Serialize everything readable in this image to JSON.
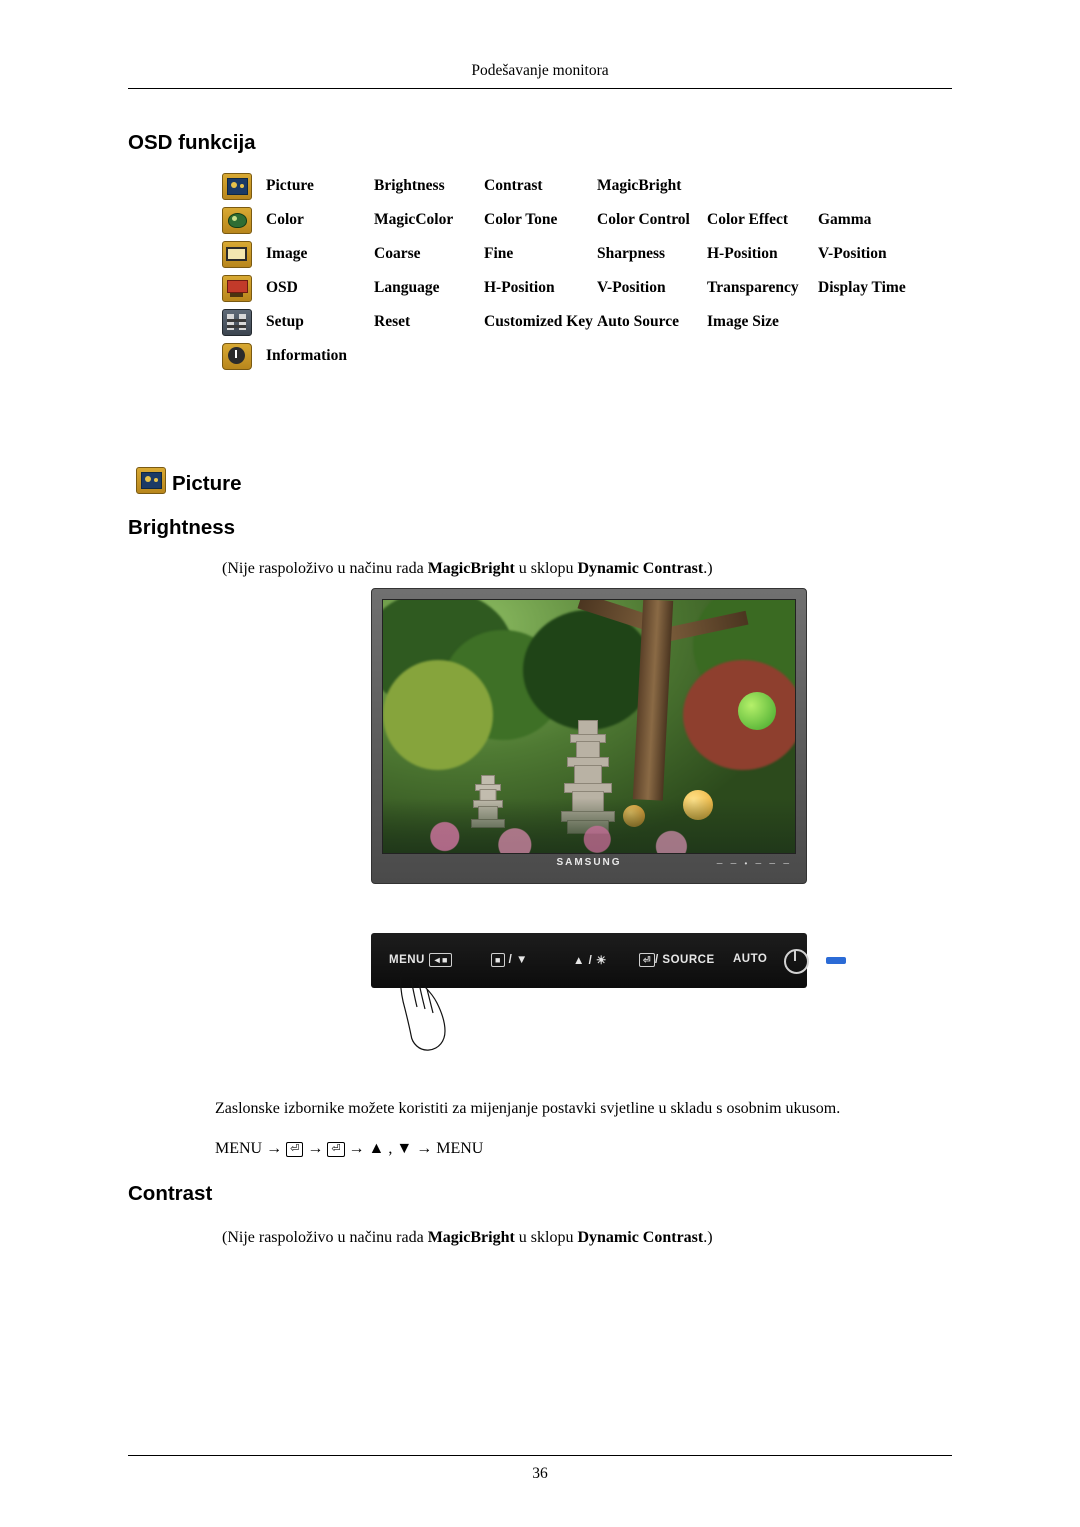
{
  "header": {
    "running_head": "Podešavanje monitora"
  },
  "footer": {
    "page_number": "36"
  },
  "headings": {
    "osd_funkcija": "OSD funkcija",
    "picture": "Picture",
    "brightness": "Brightness",
    "contrast": "Contrast"
  },
  "osd_table": {
    "rows": [
      {
        "icon": "picture-icon",
        "label": "Picture",
        "cells": [
          "Brightness",
          "Contrast",
          "MagicBright",
          "",
          ""
        ]
      },
      {
        "icon": "color-icon",
        "label": "Color",
        "cells": [
          "MagicColor",
          "Color Tone",
          "Color Control",
          "Color Effect",
          "Gamma"
        ]
      },
      {
        "icon": "image-icon",
        "label": "Image",
        "cells": [
          "Coarse",
          "Fine",
          "Sharpness",
          "H-Position",
          "V-Position"
        ]
      },
      {
        "icon": "osd-icon",
        "label": "OSD",
        "cells": [
          "Language",
          "H-Position",
          "V-Position",
          "Transparency",
          "Display Time"
        ]
      },
      {
        "icon": "setup-icon",
        "label": "Setup",
        "cells": [
          "Reset",
          "Customized Key",
          "Auto Source",
          "Image Size",
          ""
        ]
      },
      {
        "icon": "information-icon",
        "label": "Information",
        "cells": [
          "",
          "",
          "",
          "",
          ""
        ]
      }
    ]
  },
  "notes": {
    "brightness_note_prefix": "(Nije raspoloživo u načinu rada ",
    "magicbright": "MagicBright",
    "note_middle": " u sklopu ",
    "dynamic_contrast": "Dynamic Contrast",
    "note_suffix": ".)"
  },
  "body": {
    "description": "Zaslonske izbornike možete koristiti za mijenjanje postavki svjetline u skladu s osobnim ukusom.",
    "menu_path_start": "MENU →",
    "menu_path_middle": "→",
    "menu_path_arrows": "→ ▲ , ▼ → MENU"
  },
  "monitor": {
    "brand": "SAMSUNG",
    "bezel_buttons": "─ ─ • ─ ─ ─"
  },
  "control_panel": {
    "items": [
      {
        "name": "menu-button",
        "label": "MENU"
      },
      {
        "name": "brightness-down-button",
        "label": "/ ▼"
      },
      {
        "name": "brightness-up-button",
        "label": "▲ / ☀"
      },
      {
        "name": "source-button",
        "label": "/ SOURCE"
      },
      {
        "name": "auto-button",
        "label": "AUTO"
      },
      {
        "name": "power-button",
        "label": ""
      },
      {
        "name": "power-led",
        "label": ""
      }
    ]
  }
}
